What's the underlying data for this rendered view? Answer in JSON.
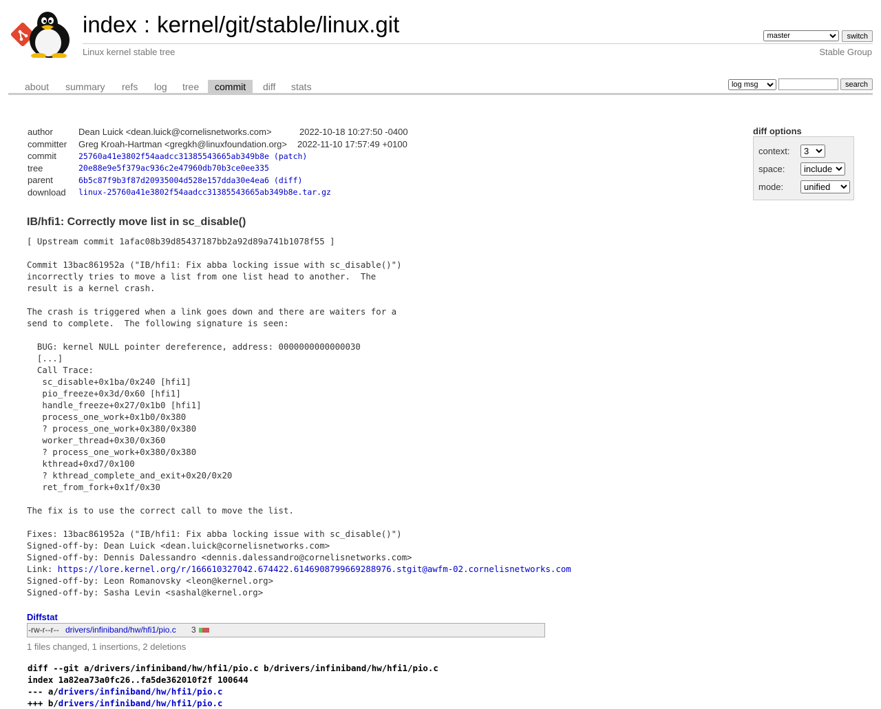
{
  "header": {
    "title_index": "index",
    "title_sep": ":",
    "title_repo": "kernel/git/stable/linux.git",
    "subtitle": "Linux kernel stable tree",
    "branch_selected": "master",
    "switch_label": "switch",
    "group_link": "Stable Group"
  },
  "tabs": [
    {
      "label": "about"
    },
    {
      "label": "summary"
    },
    {
      "label": "refs"
    },
    {
      "label": "log"
    },
    {
      "label": "tree"
    },
    {
      "label": "commit",
      "active": true
    },
    {
      "label": "diff"
    },
    {
      "label": "stats"
    }
  ],
  "search": {
    "scope_selected": "log msg",
    "query": "",
    "button_label": "search"
  },
  "commit_info": {
    "author_label": "author",
    "author": "Dean Luick <dean.luick@cornelisnetworks.com>",
    "author_date": "2022-10-18 10:27:50 -0400",
    "committer_label": "committer",
    "committer": "Greg Kroah-Hartman <gregkh@linuxfoundation.org>",
    "committer_date": "2022-11-10 17:57:49 +0100",
    "commit_label": "commit",
    "commit_hash": "25760a41e3802f54aadcc31385543665ab349b8e",
    "patch_link": "(patch)",
    "tree_label": "tree",
    "tree_hash": "20e88e9e5f379ac936c2e47960db70b3ce0ee335",
    "parent_label": "parent",
    "parent_hash": "6b5c87f9b3f87d20935004d528e157dda30e4ea6",
    "diff_link": "(diff)",
    "download_label": "download",
    "download_file": "linux-25760a41e3802f54aadcc31385543665ab349b8e.tar.gz"
  },
  "diff_options": {
    "title": "diff options",
    "context_label": "context:",
    "context_value": "3",
    "space_label": "space:",
    "space_value": "include",
    "mode_label": "mode:",
    "mode_value": "unified"
  },
  "message": {
    "subject": "IB/hfi1: Correctly move list in sc_disable()",
    "body_before_link": "[ Upstream commit 1afac08b39d85437187bb2a92d89a741b1078f55 ]\n\nCommit 13bac861952a (\"IB/hfi1: Fix abba locking issue with sc_disable()\")\nincorrectly tries to move a list from one list head to another.  The\nresult is a kernel crash.\n\nThe crash is triggered when a link goes down and there are waiters for a\nsend to complete.  The following signature is seen:\n\n  BUG: kernel NULL pointer dereference, address: 0000000000000030\n  [...]\n  Call Trace:\n   sc_disable+0x1ba/0x240 [hfi1]\n   pio_freeze+0x3d/0x60 [hfi1]\n   handle_freeze+0x27/0x1b0 [hfi1]\n   process_one_work+0x1b0/0x380\n   ? process_one_work+0x380/0x380\n   worker_thread+0x30/0x360\n   ? process_one_work+0x380/0x380\n   kthread+0xd7/0x100\n   ? kthread_complete_and_exit+0x20/0x20\n   ret_from_fork+0x1f/0x30\n\nThe fix is to use the correct call to move the list.\n\nFixes: 13bac861952a (\"IB/hfi1: Fix abba locking issue with sc_disable()\")\nSigned-off-by: Dean Luick <dean.luick@cornelisnetworks.com>\nSigned-off-by: Dennis Dalessandro <dennis.dalessandro@cornelisnetworks.com>\n",
    "link_prefix": "Link: ",
    "link_url": "https://lore.kernel.org/r/166610327042.674422.6146908799669288976.stgit@awfm-02.cornelisnetworks.com",
    "body_after_link": "\nSigned-off-by: Leon Romanovsky <leon@kernel.org>\nSigned-off-by: Sasha Levin <sashal@kernel.org>"
  },
  "diffstat": {
    "header": "Diffstat",
    "mode": "-rw-r--r--",
    "path": "drivers/infiniband/hw/hfi1/pio.c",
    "count": "3",
    "insertions": 1,
    "deletions": 2,
    "summary": "1 files changed, 1 insertions, 2 deletions"
  },
  "diff_header": {
    "line1": "diff --git a/drivers/infiniband/hw/hfi1/pio.c b/drivers/infiniband/hw/hfi1/pio.c",
    "line2": "index 1a82ea73a0fc26..fa5de362010f2f 100644",
    "line3_prefix": "--- a/",
    "line3_path": "drivers/infiniband/hw/hfi1/pio.c",
    "line4_prefix": "+++ b/",
    "line4_path": "drivers/infiniband/hw/hfi1/pio.c"
  },
  "colors": {
    "link": "#0000cc",
    "tab_active_bg": "#cccccc",
    "add": "#55cc55",
    "remove": "#cc5555"
  },
  "icons": {
    "logo": "tux-penguin-with-git-logo"
  }
}
